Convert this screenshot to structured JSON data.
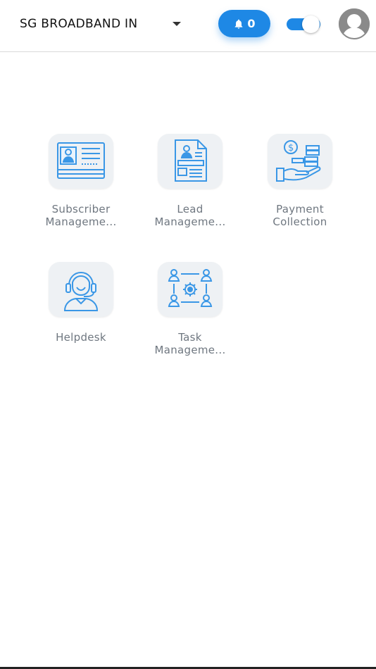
{
  "header": {
    "org_name": "SG BROADBAND IN",
    "notification_count": "0",
    "toggle_on": true
  },
  "tiles": [
    {
      "line1": "Subscriber",
      "line2": "Manageme..."
    },
    {
      "line1": "Lead",
      "line2": "Manageme..."
    },
    {
      "line1": "Payment",
      "line2": "Collection"
    },
    {
      "line1": "Helpdesk",
      "line2": ""
    },
    {
      "line1": "Task",
      "line2": "Manageme..."
    }
  ],
  "colors": {
    "accent": "#1e88e5",
    "icon_blue": "#3a97e6",
    "tile_bg": "#eef1f4",
    "label_gray": "#6f7780"
  }
}
